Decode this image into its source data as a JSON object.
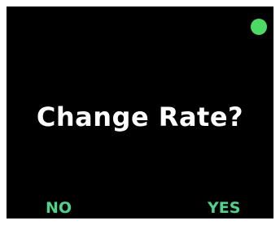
{
  "prompt": {
    "text": "Change Rate?"
  },
  "softkeys": {
    "left_label": "NO",
    "right_label": "YES"
  },
  "status": {
    "indicator": "status-dot-icon"
  },
  "colors": {
    "background": "#000000",
    "text": "#ffffff",
    "accent": "#4cd964",
    "softkey": "#52d18a"
  }
}
